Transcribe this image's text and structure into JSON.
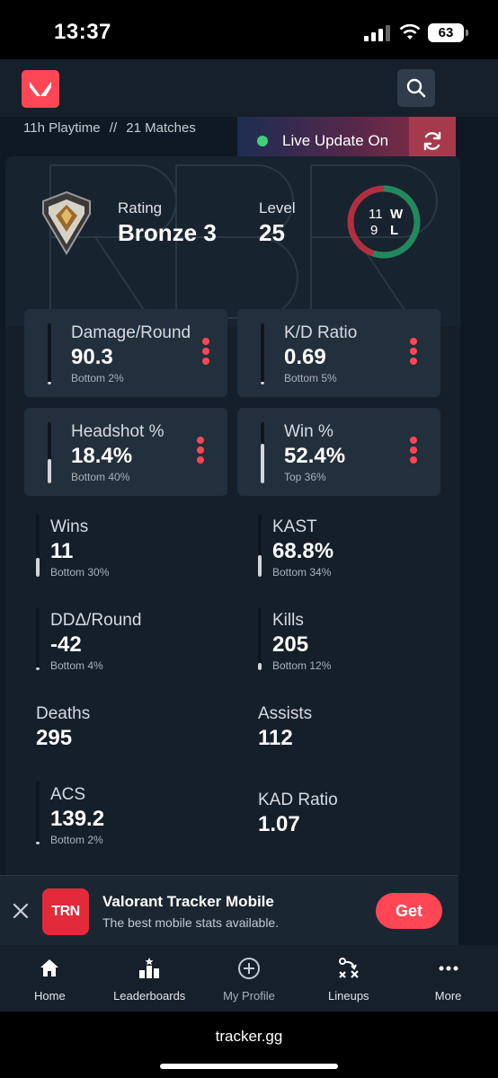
{
  "status_bar": {
    "time": "13:37",
    "battery": "63"
  },
  "header": {
    "logo_icon": "valorant-logo-icon",
    "search_icon": "search-icon"
  },
  "sub_info": {
    "playtime": "11h Playtime",
    "separator": "//",
    "matches": "21 Matches"
  },
  "live_update": {
    "label": "Live Update On",
    "status_color": "#3cd07a",
    "refresh_icon": "refresh-icon"
  },
  "rank": {
    "rating_label": "Rating",
    "rating_value": "Bronze 3",
    "level_label": "Level",
    "level_value": "25"
  },
  "win_loss": {
    "wins": "11",
    "losses": "9",
    "w_label": "W",
    "l_label": "L",
    "win_color": "#1f8a5e",
    "loss_color": "#b0303f"
  },
  "stat_cards": [
    {
      "label": "Damage/Round",
      "value": "90.3",
      "sub": "Bottom 2%",
      "percentile": 0.02
    },
    {
      "label": "K/D Ratio",
      "value": "0.69",
      "sub": "Bottom 5%",
      "percentile": 0.05
    },
    {
      "label": "Headshot %",
      "value": "18.4%",
      "sub": "Bottom 40%",
      "percentile": 0.4
    },
    {
      "label": "Win %",
      "value": "52.4%",
      "sub": "Top 36%",
      "percentile": 0.64
    }
  ],
  "stats": [
    {
      "label": "Wins",
      "value": "11",
      "sub": "Bottom 30%",
      "percentile": 0.3
    },
    {
      "label": "KAST",
      "value": "68.8%",
      "sub": "Bottom 34%",
      "percentile": 0.34
    },
    {
      "label": "DDΔ/Round",
      "value": "-42",
      "sub": "Bottom 4%",
      "percentile": 0.04
    },
    {
      "label": "Kills",
      "value": "205",
      "sub": "Bottom 12%",
      "percentile": 0.12
    },
    {
      "label": "Deaths",
      "value": "295"
    },
    {
      "label": "Assists",
      "value": "112"
    },
    {
      "label": "ACS",
      "value": "139.2",
      "sub": "Bottom 2%",
      "percentile": 0.02
    },
    {
      "label": "KAD Ratio",
      "value": "1.07"
    }
  ],
  "ad": {
    "logo_text": "TRN",
    "title": "Valorant Tracker Mobile",
    "description": "The best mobile stats available.",
    "cta": "Get",
    "accent": "#ff4655"
  },
  "nav": [
    {
      "label": "Home",
      "icon": "home-icon"
    },
    {
      "label": "Leaderboards",
      "icon": "leaderboards-icon"
    },
    {
      "label": "My Profile",
      "icon": "add-circle-icon"
    },
    {
      "label": "Lineups",
      "icon": "lineups-icon"
    },
    {
      "label": "More",
      "icon": "more-icon"
    }
  ],
  "browser": {
    "url": "tracker.gg"
  }
}
